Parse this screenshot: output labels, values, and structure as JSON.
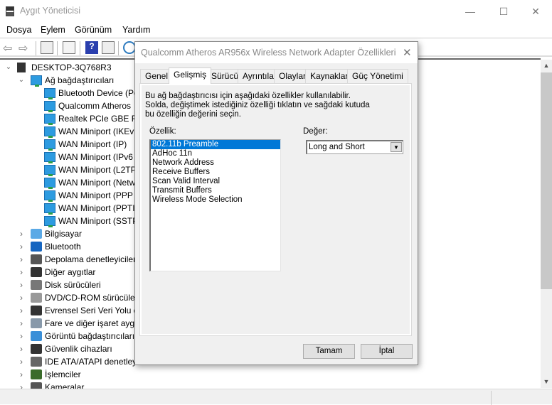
{
  "window": {
    "title": "Aygıt Yöneticisi",
    "minimize": "—",
    "maximize": "☐",
    "close": "✕"
  },
  "menu": [
    "Dosya",
    "Eylem",
    "Görünüm",
    "Yardım"
  ],
  "toolbar_icons": [
    "back-icon",
    "forward-icon",
    "show-hide-console-tree-icon",
    "properties-icon",
    "help-icon",
    "action-pane-icon",
    "scan-hardware-icon"
  ],
  "tree": {
    "root": "DESKTOP-3Q768R3",
    "network": {
      "label": "Ağ bağdaştırıcıları",
      "children": [
        "Bluetooth Device (Pe",
        "Qualcomm Atheros",
        "Realtek PCIe GBE Far",
        "WAN Miniport (IKEv",
        "WAN Miniport (IP)",
        "WAN Miniport (IPv6",
        "WAN Miniport (L2TP",
        "WAN Miniport (Netw",
        "WAN Miniport (PPP",
        "WAN Miniport (PPTI",
        "WAN Miniport (SSTP"
      ]
    },
    "categories": [
      {
        "label": "Bilgisayar",
        "icon": "computer-icon",
        "color": "#5aa9e6"
      },
      {
        "label": "Bluetooth",
        "icon": "bluetooth-icon",
        "color": "#1565c0"
      },
      {
        "label": "Depolama denetleyiciler",
        "icon": "storage-controller-icon",
        "color": "#555555"
      },
      {
        "label": "Diğer aygıtlar",
        "icon": "other-devices-icon",
        "color": "#333333"
      },
      {
        "label": "Disk sürücüleri",
        "icon": "disk-drive-icon",
        "color": "#777777"
      },
      {
        "label": "DVD/CD-ROM sürücüler",
        "icon": "dvd-icon",
        "color": "#999999"
      },
      {
        "label": "Evrensel Seri Veri Yolu de",
        "icon": "usb-icon",
        "color": "#333333"
      },
      {
        "label": "Fare ve diğer işaret aygıt",
        "icon": "mouse-icon",
        "color": "#8899aa"
      },
      {
        "label": "Görüntü bağdaştırıcıları",
        "icon": "display-adapter-icon",
        "color": "#3a8fd8"
      },
      {
        "label": "Güvenlik cihazları",
        "icon": "security-device-icon",
        "color": "#333333"
      },
      {
        "label": "IDE ATA/ATAPI denetley",
        "icon": "ide-icon",
        "color": "#666666"
      },
      {
        "label": "İşlemciler",
        "icon": "processor-icon",
        "color": "#3a6b2a"
      },
      {
        "label": "Kameralar",
        "icon": "camera-icon",
        "color": "#555555"
      }
    ]
  },
  "dialog": {
    "title": "Qualcomm Atheros AR956x Wireless Network Adapter Özellikleri",
    "tabs": [
      "Genel",
      "Gelişmiş",
      "Sürücü",
      "Ayrıntılar",
      "Olaylar",
      "Kaynaklar",
      "Güç Yönetimi"
    ],
    "active_tab": "Gelişmiş",
    "description": "Bu ağ bağdaştırıcısı için aşağıdaki özellikler kullanılabilir. Solda, değiştimek istediğiniz özelliği tıklatın ve sağdaki kutuda bu özelliğin değerini seçin.",
    "property_label": "Özellik:",
    "value_label": "Değer:",
    "properties": [
      "802.11b Preamble",
      "AdHoc 11n",
      "Network Address",
      "Receive Buffers",
      "Scan Valid Interval",
      "Transmit Buffers",
      "Wireless Mode Selection"
    ],
    "selected_property": "802.11b Preamble",
    "value": "Long and Short",
    "ok": "Tamam",
    "cancel": "İptal",
    "selection_color": "#0078d7"
  }
}
